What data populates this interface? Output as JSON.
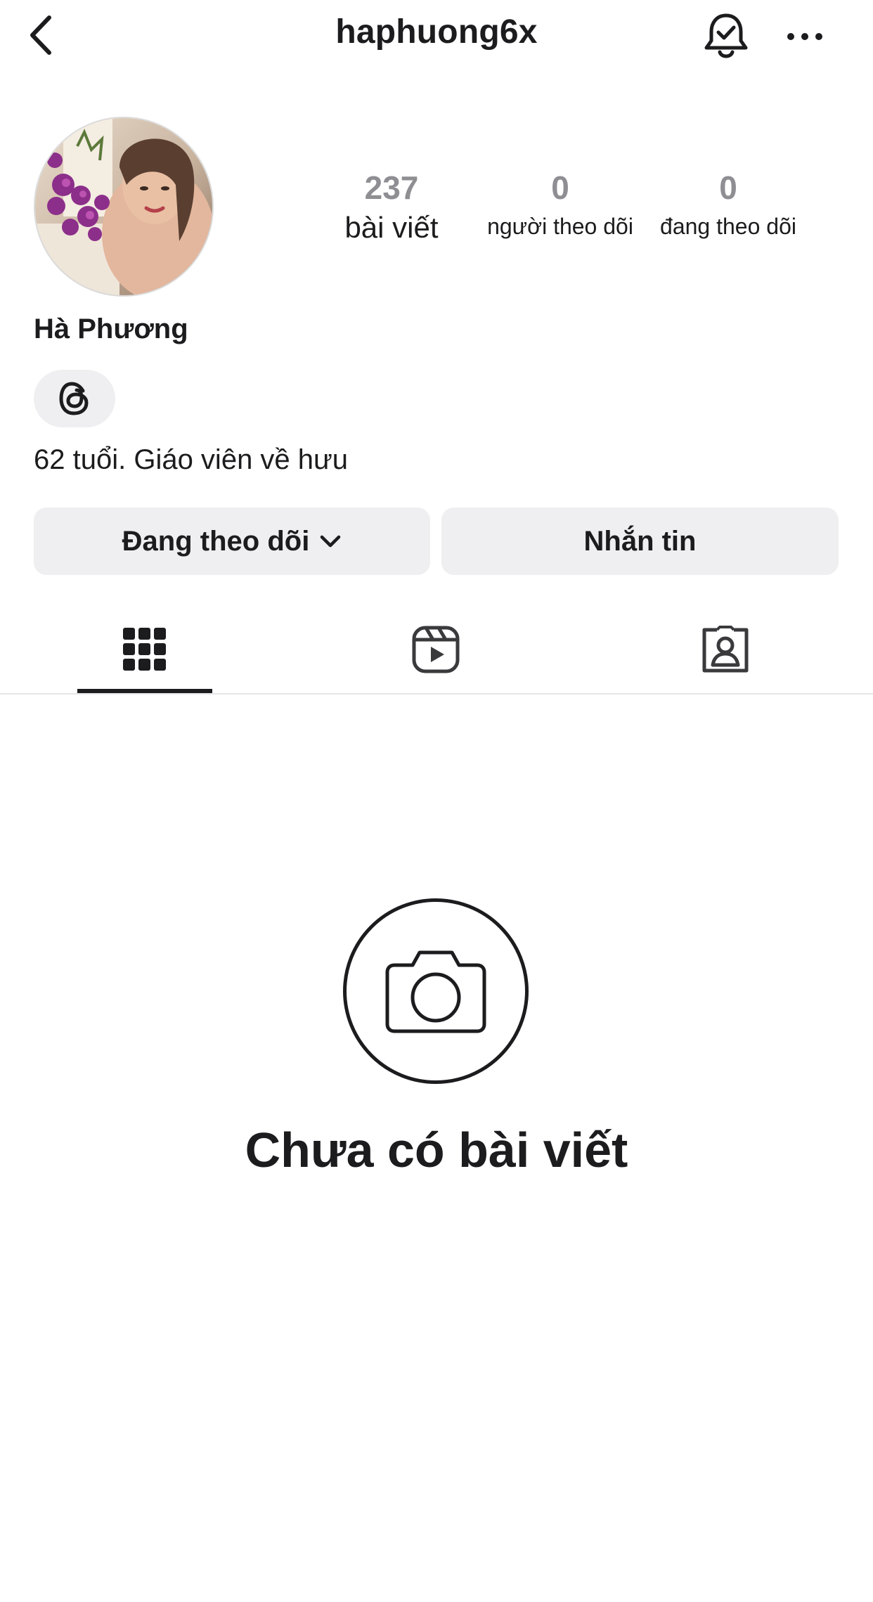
{
  "header": {
    "username": "haphuong6x",
    "icons": {
      "back": "chevron-left-icon",
      "notification": "bell-check-icon",
      "more": "more-horizontal-icon"
    }
  },
  "profile": {
    "avatar": "avatar-photo",
    "stats": {
      "posts": {
        "value": "237",
        "label": "bài viết"
      },
      "followers": {
        "value": "0",
        "label": "người theo dõi"
      },
      "following": {
        "value": "0",
        "label": "đang theo dõi"
      }
    },
    "full_name": "Hà Phương",
    "threads_badge_icon": "threads-icon",
    "bio": "62 tuổi. Giáo viên về hưu"
  },
  "actions": {
    "following_label": "Đang theo dõi",
    "message_label": "Nhắn tin"
  },
  "tabs": [
    {
      "name": "grid",
      "icon": "grid-icon",
      "active": true
    },
    {
      "name": "reels",
      "icon": "reels-icon",
      "active": false
    },
    {
      "name": "tagged",
      "icon": "tagged-person-icon",
      "active": false
    }
  ],
  "empty_state": {
    "icon": "camera-icon",
    "title": "Chưa có bài viết"
  },
  "colors": {
    "text": "#1c1c1e",
    "muted": "#8e8e93",
    "button_bg": "#efeff1",
    "divider": "#e6e6e8"
  }
}
